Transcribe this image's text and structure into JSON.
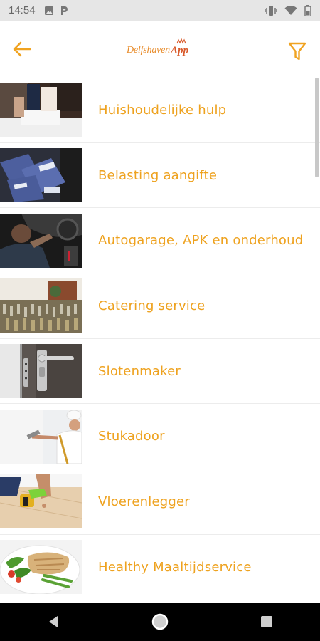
{
  "status_bar": {
    "time": "14:54",
    "icons": [
      "image-icon",
      "p-icon",
      "vibrate-icon",
      "wifi-icon",
      "battery-icon"
    ]
  },
  "app_bar": {
    "logo_main": "Delfshaven",
    "logo_app": "App",
    "back_icon": "arrow-left-icon",
    "filter_icon": "filter-icon"
  },
  "colors": {
    "accent": "#eea21f",
    "icon_accent": "#f0a321",
    "logo_orange": "#e88c2b",
    "logo_red": "#d95a2b",
    "status_bar_bg": "#e6e6e6",
    "nav_bar_bg": "#000000"
  },
  "services": [
    {
      "label": "Huishoudelijke hulp",
      "image": "cleaning-photo"
    },
    {
      "label": "Belasting aangifte",
      "image": "envelopes-photo"
    },
    {
      "label": "Autogarage, APK en onderhoud",
      "image": "mechanic-photo"
    },
    {
      "label": "Catering service",
      "image": "catering-photo"
    },
    {
      "label": "Slotenmaker",
      "image": "door-lock-photo"
    },
    {
      "label": "Stukadoor",
      "image": "plasterer-photo"
    },
    {
      "label": "Vloerenlegger",
      "image": "floor-layer-photo"
    },
    {
      "label": "Healthy Maaltijdservice",
      "image": "healthy-meal-photo"
    }
  ],
  "nav_bar": {
    "icons": [
      "back-triangle-icon",
      "home-circle-icon",
      "recents-square-icon"
    ]
  }
}
